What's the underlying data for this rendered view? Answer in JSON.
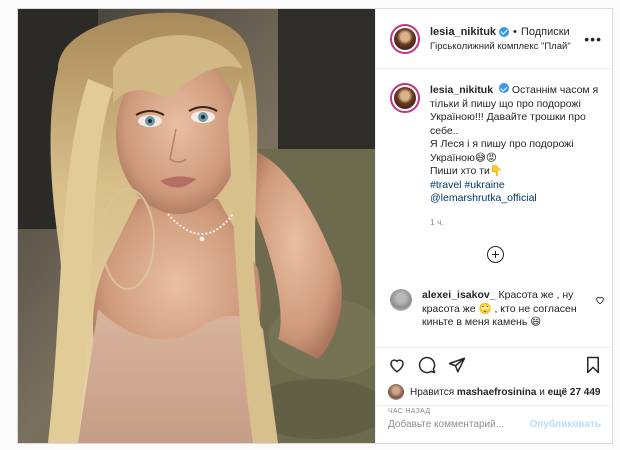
{
  "post": {
    "username": "lesia_nikituk",
    "dot": "•",
    "follow_label": "Подписки",
    "location": "Гірськолижний комплекс \"Плай\"",
    "more_icon": "more-dots-icon"
  },
  "caption": {
    "username": "lesia_nikituk",
    "lines": [
      "Останнім часом я",
      "тільки й пишу що про подорожі",
      "Україною!!! Давайте трошки про",
      "себе..",
      "Я Леся і я пишу про подорожі",
      "Україною😅😡",
      "Пиши хто ти👇"
    ],
    "hashtags": "#travel #ukraine",
    "mention": "@lemarshrutka_official",
    "time": "1 ч."
  },
  "comment": {
    "username": "alexei_isakov_",
    "lines": [
      "Красота же , ну",
      "красота же 🙄 , кто не согласен",
      "киньте в меня камень 😄"
    ]
  },
  "likes": {
    "prefix": "Нравится",
    "user": "mashaefrosinina",
    "and": "и",
    "more": "ещё 27 449"
  },
  "timestamp": "ЧАС НАЗАД",
  "add_comment": {
    "placeholder": "Добавьте комментарий...",
    "publish_label": "Опубликовать"
  },
  "colors": {
    "accent_blue": "#3897f0",
    "link": "#00376b",
    "publish_disabled": "#b2dffc",
    "border": "#dbdbdb"
  }
}
